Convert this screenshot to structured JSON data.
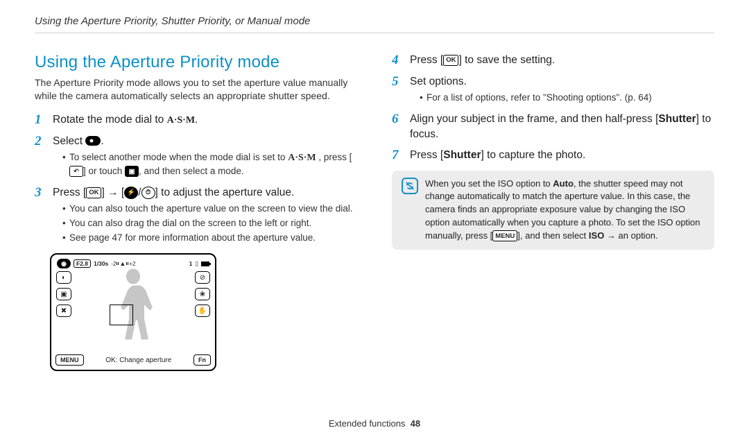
{
  "breadcrumb": "Using the Aperture Priority, Shutter Priority, or Manual mode",
  "heading": "Using the Aperture Priority mode",
  "intro": "The Aperture Priority mode allows you to set the aperture value manually while the camera automatically selects an appropriate shutter speed.",
  "steps": {
    "s1_a": "Rotate the mode dial to ",
    "s1_b": ".",
    "s2_a": "Select ",
    "s2_b": ".",
    "s2_n1_a": "To select another mode when the mode dial is set to ",
    "s2_n1_b": ", press [",
    "s2_n1_c": "] or touch ",
    "s2_n1_d": ", and then select a mode.",
    "s3_a": "Press [",
    "s3_b": "] → [",
    "s3_c": "/",
    "s3_d": "] to adjust the aperture value.",
    "s3_n1": "You can also touch the aperture value on the screen to view the dial.",
    "s3_n2": "You can also drag the dial on the screen to the left or right.",
    "s3_n3": "See page 47 for more information about the aperture value.",
    "s4_a": "Press [",
    "s4_b": "] to save the setting.",
    "s5": "Set options.",
    "s5_n1": "For a list of options, refer to \"Shooting options\". (p. 64)",
    "s6_a": "Align your subject in the frame, and then half-press [",
    "s6_b": "Shutter",
    "s6_c": "] to focus.",
    "s7_a": "Press [",
    "s7_b": "Shutter",
    "s7_c": "] to capture the photo."
  },
  "camview": {
    "fval": "F2.8",
    "shutter": "1/30s",
    "ev_left": "-2",
    "ev_mid": "0",
    "ev_right": "+2",
    "count": "1",
    "menu": "MENU",
    "ok": "OK: Change aperture",
    "fn": "Fn"
  },
  "note": {
    "a": "When you set the ISO option to ",
    "auto": "Auto",
    "b": ", the shutter speed may not change automatically to match the aperture value. In this case, the camera finds an appropriate exposure value by changing the ISO option automatically when you capture a photo. To set the ISO option manually, press [",
    "c": "], and then select ",
    "iso": "ISO",
    "d": " → an option."
  },
  "footer": {
    "label": "Extended functions",
    "page": "48"
  },
  "glyph": {
    "ok": "OK",
    "menu": "MENU",
    "asm": "A·S·M"
  }
}
